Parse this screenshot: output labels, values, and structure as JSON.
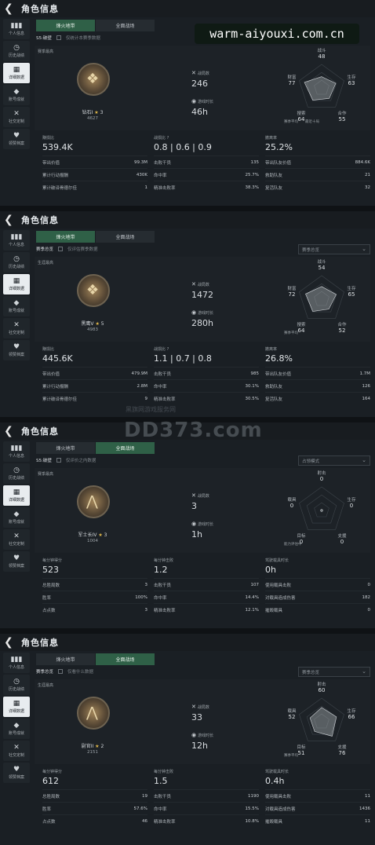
{
  "watermark": "warm-aiyouxi.com.cn",
  "watermark2": "DD373.com",
  "watermark2_sub": "黑旗网游戏服务网",
  "title": "角色信息",
  "sidebar": [
    "个人信息",
    "历史战绩",
    "详细数据",
    "账号成就",
    "社交定制",
    "领赞档案"
  ],
  "panels": [
    {
      "tabs": [
        "烽火地带",
        "全面战场"
      ],
      "active_tab": 0,
      "season": "S5:破壁",
      "filter": "仅统计本赛季数据",
      "dropdown": "",
      "career_label": "赛季最高",
      "rank_name": "钻石I",
      "rank_stars": "3",
      "rank_points": "4627",
      "stat1_label": "战局数",
      "stat1_value": "246",
      "stat2_label": "游戏时长",
      "stat2_value": "46h",
      "radar": {
        "top": [
          "战斗",
          "48"
        ],
        "right": [
          "生存",
          "63"
        ],
        "bottom_right": [
          "合作",
          "55"
        ],
        "bottom_left": [
          "搜索",
          "64"
        ],
        "left": [
          "财富",
          "77"
        ],
        "legend": "赛季平均　　最近十局",
        "v": [
          0.48,
          0.63,
          0.55,
          0.64,
          0.77
        ]
      },
      "col1": {
        "head": "赚损比",
        "big": "539.4K",
        "rows": [
          [
            "带出价值",
            "99.3M"
          ],
          [
            "累计行动报酬",
            "430K"
          ],
          [
            "累计破译骨德尔佳",
            "1"
          ]
        ]
      },
      "col2": {
        "head": "战损比 ?",
        "big": "0.8 | 0.6 | 0.9",
        "rows": [
          [
            "击败干员",
            "135"
          ],
          [
            "命中率",
            "25.7%"
          ],
          [
            "精准击败率",
            "38.3%"
          ]
        ]
      },
      "col3": {
        "head": "撤离率",
        "big": "25.2%",
        "rows": [
          [
            "带出队友价值",
            "884.6K"
          ],
          [
            "救助队友",
            "21"
          ],
          [
            "复活队友",
            "32"
          ]
        ]
      }
    },
    {
      "tabs": [
        "烽火地带",
        "全面战场"
      ],
      "active_tab": 0,
      "season": "赛季总览",
      "filter": "仅评估赛季数据",
      "dropdown": "赛季总览",
      "career_label": "生涯最高",
      "rank_name": "黑鹰V",
      "rank_stars": "5",
      "rank_points": "4983",
      "stat1_label": "战局数",
      "stat1_value": "1472",
      "stat2_label": "游戏时长",
      "stat2_value": "280h",
      "radar": {
        "top": [
          "战斗",
          "54"
        ],
        "right": [
          "生存",
          "65"
        ],
        "bottom_right": [
          "合作",
          "52"
        ],
        "bottom_left": [
          "搜索",
          "64"
        ],
        "left": [
          "财富",
          "72"
        ],
        "legend": "赛季平均",
        "v": [
          0.54,
          0.65,
          0.52,
          0.64,
          0.72
        ]
      },
      "col1": {
        "head": "赚损比",
        "big": "445.6K",
        "rows": [
          [
            "带出价值",
            "479.9M"
          ],
          [
            "累计行动报酬",
            "2.8M"
          ],
          [
            "累计破译骨德尔佳",
            "9"
          ]
        ]
      },
      "col2": {
        "head": "战损比 ?",
        "big": "1.1 | 0.7 | 0.8",
        "rows": [
          [
            "击败干员",
            "985"
          ],
          [
            "命中率",
            "30.1%"
          ],
          [
            "精准击败率",
            "30.5%"
          ]
        ]
      },
      "col3": {
        "head": "撤离率",
        "big": "26.8%",
        "rows": [
          [
            "带出队友价值",
            "1.7M"
          ],
          [
            "救助队友",
            "126"
          ],
          [
            "复活队友",
            "164"
          ]
        ]
      }
    },
    {
      "tabs": [
        "烽火地带",
        "全面战场"
      ],
      "active_tab": 1,
      "season": "S5:破壁",
      "filter": "仅评价之内数据",
      "dropdown": "占领模式",
      "career_label": "赛季最高",
      "rank_name": "军士长IV",
      "rank_stars": "3",
      "rank_points": "1004",
      "stat1_label": "战局数",
      "stat1_value": "3",
      "stat2_label": "游戏时长",
      "stat2_value": "1h",
      "radar": {
        "top": [
          "射击",
          "0"
        ],
        "right": [
          "生存",
          "0"
        ],
        "bottom_right": [
          "支援",
          "0"
        ],
        "bottom_left": [
          "目标",
          "0"
        ],
        "left": [
          "载具",
          "0"
        ],
        "legend": "能力评估中",
        "v": [
          0.05,
          0.05,
          0.05,
          0.05,
          0.05
        ]
      },
      "col1": {
        "head": "每分钟得分",
        "big": "523",
        "rows": [
          [
            "总胜局数",
            "3"
          ],
          [
            "胜率",
            "100%"
          ],
          [
            "占点数",
            "3"
          ]
        ]
      },
      "col2": {
        "head": "每分钟击败",
        "big": "1.2",
        "rows": [
          [
            "击败干员",
            "107"
          ],
          [
            "命中率",
            "14.4%"
          ],
          [
            "精准击败率",
            "12.1%"
          ]
        ]
      },
      "col3": {
        "head": "驾驶载具时长",
        "big": "0h",
        "rows": [
          [
            "使用载具击败",
            "0"
          ],
          [
            "对载具造成伤害",
            "182"
          ],
          [
            "摧毁载具",
            "0"
          ]
        ]
      }
    },
    {
      "tabs": [
        "烽火地带",
        "全面战场"
      ],
      "active_tab": 1,
      "season": "赛季总览",
      "filter": "仅看什么数据",
      "dropdown": "赛季总览",
      "career_label": "生涯最高",
      "rank_name": "尉官II",
      "rank_stars": "2",
      "rank_points": "2151",
      "stat1_label": "战局数",
      "stat1_value": "33",
      "stat2_label": "游戏时长",
      "stat2_value": "12h",
      "radar": {
        "top": [
          "射击",
          "60"
        ],
        "right": [
          "生存",
          "66"
        ],
        "bottom_right": [
          "支援",
          "76"
        ],
        "bottom_left": [
          "目标",
          "51"
        ],
        "left": [
          "载具",
          "52"
        ],
        "legend": "赛季平均",
        "v": [
          0.6,
          0.66,
          0.76,
          0.51,
          0.52
        ]
      },
      "col1": {
        "head": "每分钟得分",
        "big": "612",
        "rows": [
          [
            "总胜局数",
            "19"
          ],
          [
            "胜率",
            "57.6%"
          ],
          [
            "占点数",
            "46"
          ]
        ]
      },
      "col2": {
        "head": "每分钟击败",
        "big": "1.5",
        "rows": [
          [
            "击败干员",
            "1190"
          ],
          [
            "命中率",
            "15.5%"
          ],
          [
            "精准击败率",
            "10.8%"
          ]
        ]
      },
      "col3": {
        "head": "驾驶载具时长",
        "big": "0.4h",
        "rows": [
          [
            "使用载具击败",
            "11"
          ],
          [
            "对载具造成伤害",
            "1436"
          ],
          [
            "摧毁载具",
            "11"
          ]
        ]
      }
    }
  ]
}
